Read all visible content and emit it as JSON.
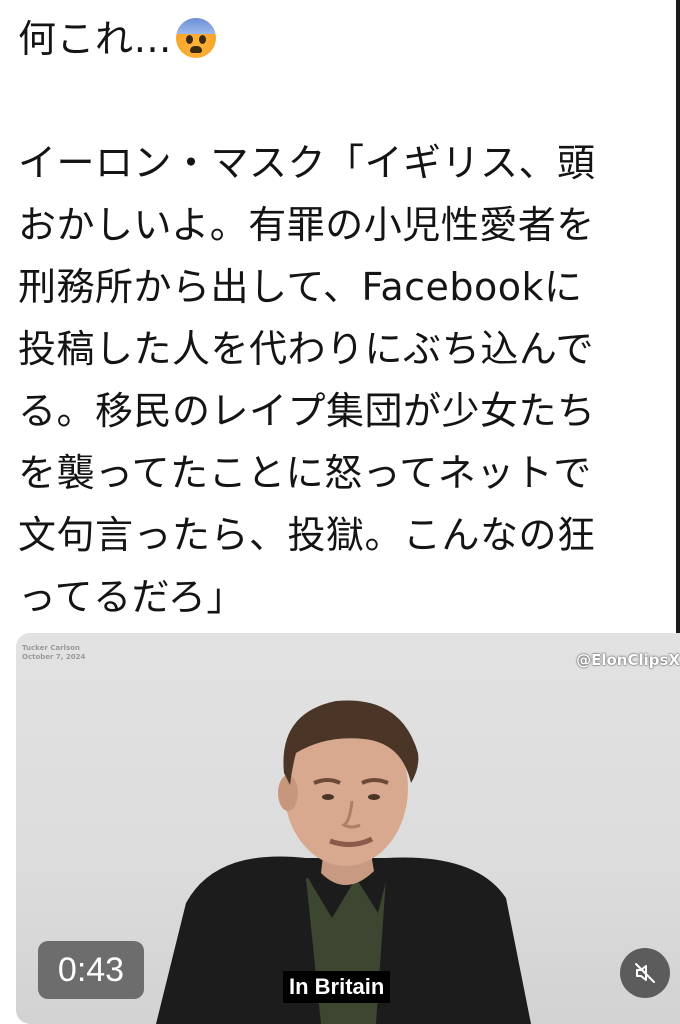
{
  "post": {
    "title": "何これ…",
    "title_emoji": "anxious-face-with-sweat-icon",
    "lines": [
      "イーロン・マスク「イギリス、頭",
      "おかしいよ。有罪の小児性愛者を",
      "刑務所から出して、Facebookに",
      "投稿した人を代わりにぶち込んで",
      "る。移民のレイプ集団が少女たち",
      "を襲ってたことに怒ってネットで",
      "文句言ったら、投獄。こんなの狂",
      "ってるだろ」"
    ]
  },
  "video": {
    "host_name": "Tucker Carlson",
    "date": "October 7, 2024",
    "channel_watermark": "@ElonClipsX",
    "duration": "0:43",
    "caption": "In Britain",
    "mute_icon": "muted-speaker-icon"
  }
}
